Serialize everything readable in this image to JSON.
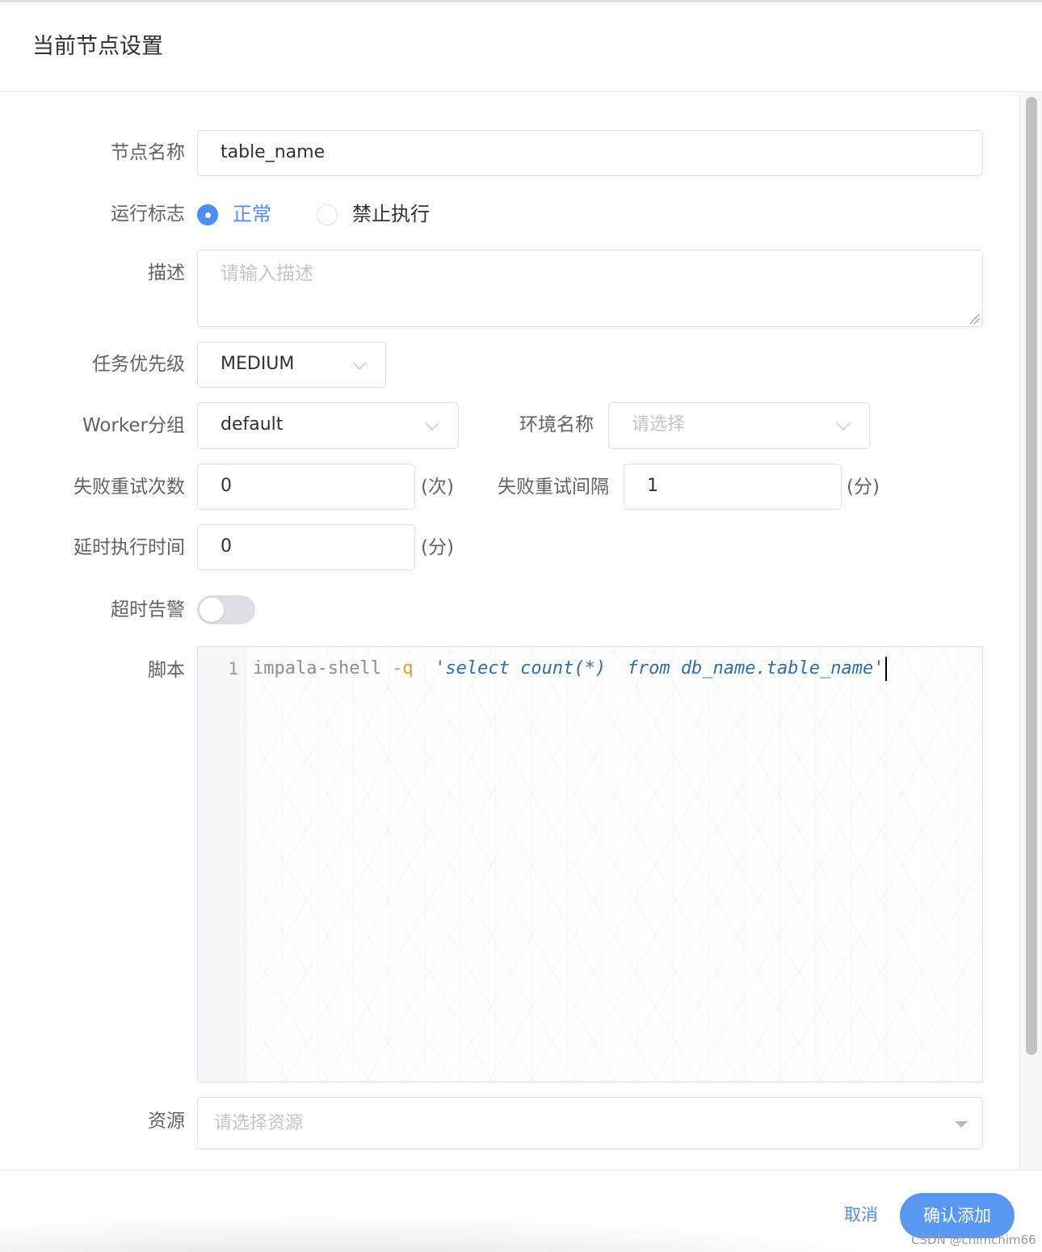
{
  "dialog": {
    "title": "当前节点设置"
  },
  "form": {
    "node_name": {
      "label": "节点名称",
      "value": "table_name"
    },
    "run_flag": {
      "label": "运行标志",
      "options": [
        {
          "label": "正常",
          "selected": true
        },
        {
          "label": "禁止执行",
          "selected": false
        }
      ]
    },
    "description": {
      "label": "描述",
      "placeholder": "请输入描述"
    },
    "priority": {
      "label": "任务优先级",
      "value": "MEDIUM"
    },
    "worker_group": {
      "label": "Worker分组",
      "value": "default"
    },
    "environment": {
      "label": "环境名称",
      "placeholder": "请选择"
    },
    "retry_times": {
      "label": "失败重试次数",
      "value": "0",
      "unit": "(次)"
    },
    "retry_interval": {
      "label": "失败重试间隔",
      "value": "1",
      "unit": "(分)"
    },
    "delay_time": {
      "label": "延时执行时间",
      "value": "0",
      "unit": "(分)"
    },
    "timeout_alarm": {
      "label": "超时告警",
      "enabled": false
    },
    "script": {
      "label": "脚本",
      "line_number": "1",
      "tokens": {
        "cmd": "impala-shell ",
        "flag": "-q",
        "str": "  'select count(*)  from db_name.table_name'"
      }
    },
    "resources": {
      "label": "资源",
      "placeholder": "请选择资源"
    }
  },
  "footer": {
    "cancel_label": "取消",
    "confirm_label": "确认添加",
    "watermark": "CSDN @chimchim66"
  },
  "colors": {
    "primary": "#4c8df6",
    "confirm_button": "#5898f2"
  }
}
